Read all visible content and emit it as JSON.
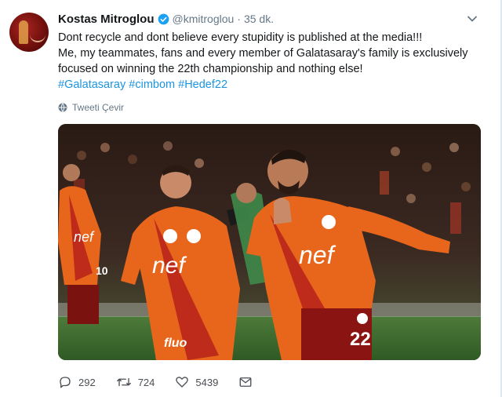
{
  "tweet": {
    "author_name": "Kostas Mitroglou",
    "handle": "@kmitroglou",
    "separator": "·",
    "time": "35 dk.",
    "text_lines": [
      "Dont recycle and dont believe every stupidity is published at the media!!!",
      "Me, my teammates, fans and every member of Galatasaray's family is exclusively",
      "focused on winning the 22th championship and nothing else!"
    ],
    "hashtags": [
      "#Galatasaray",
      "#cimbom",
      "#Hedef22"
    ],
    "translate_label": "Tweeti Çevir",
    "media": {
      "jersey_sponsor": "nef",
      "sleeve_sponsor": "fluo",
      "jersey_number": "22"
    },
    "counts": {
      "replies": "292",
      "retweets": "724",
      "likes": "5439"
    },
    "icons": {
      "verified": "verified-badge-icon",
      "caret": "chevron-down-icon",
      "translate": "globe-icon",
      "reply": "reply-icon",
      "retweet": "retweet-icon",
      "like": "heart-icon",
      "dm": "envelope-icon"
    },
    "colors": {
      "verified": "#1da1f2",
      "hashtag": "#1b95e0",
      "secondary": "#657786",
      "jersey_orange": "#e8661c",
      "jersey_red": "#b31d1a"
    }
  }
}
